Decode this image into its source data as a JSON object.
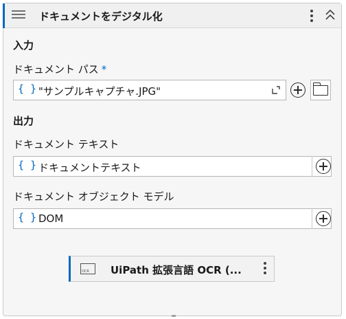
{
  "header": {
    "title": "ドキュメントをデジタル化",
    "more_icon": "kebab-icon",
    "collapse_icon": "chevron-up-icon"
  },
  "input_section": {
    "title": "入力"
  },
  "document_path": {
    "label": "ドキュメント パス",
    "required_mark": "*",
    "brace": "{ }",
    "value": "\"サンプルキャプチャ.JPG\""
  },
  "output_section": {
    "title": "出力"
  },
  "document_text": {
    "label": "ドキュメント テキスト",
    "brace": "{ }",
    "value": "ドキュメントテキスト"
  },
  "document_object_model": {
    "label": "ドキュメント オブジェクト モデル",
    "brace": "{ }",
    "value": "DOM"
  },
  "activity": {
    "name": "UiPath 拡張言語 OCR (...",
    "icon_text": "OCR"
  },
  "colors": {
    "accent": "#0067c0"
  }
}
